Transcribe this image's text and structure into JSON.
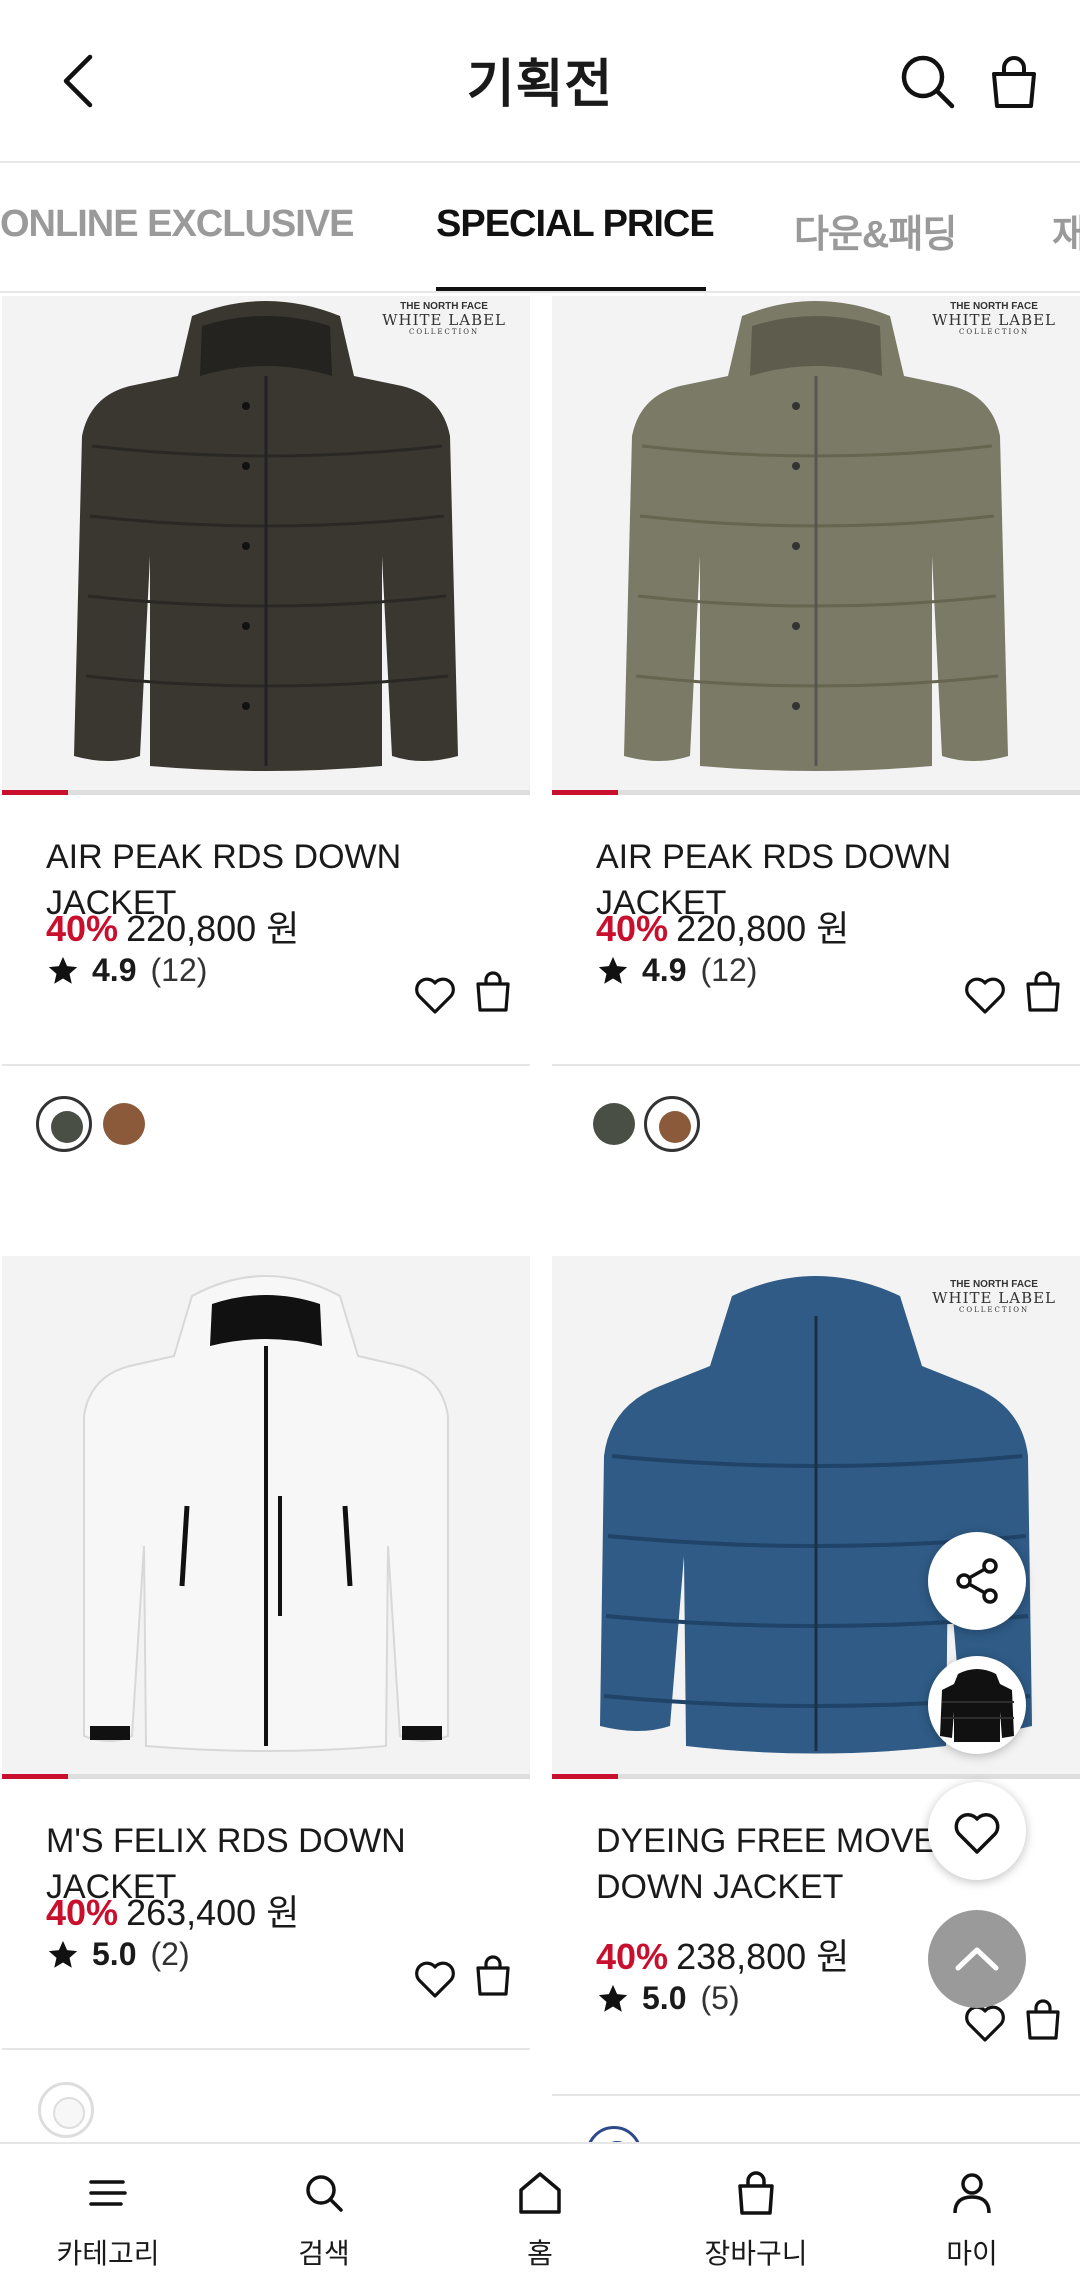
{
  "header": {
    "title": "기획전"
  },
  "tabs": [
    {
      "label": "ONLINE EXCLUSIVE"
    },
    {
      "label": "SPECIAL PRICE"
    },
    {
      "label": "다운&패딩"
    },
    {
      "label": "재"
    }
  ],
  "brand_badge": {
    "tnf": "THE NORTH FACE",
    "line1": "WHITE LABEL",
    "line2": "COLLECTION"
  },
  "products": [
    {
      "name": "AIR PEAK RDS DOWN JACKET",
      "discount": "40%",
      "price": "220,800 원",
      "rating": "4.9",
      "reviews": "(12)",
      "color": "#3a3731"
    },
    {
      "name": "AIR PEAK RDS DOWN JACKET",
      "discount": "40%",
      "price": "220,800 원",
      "rating": "4.9",
      "reviews": "(12)",
      "color": "#7b7a66"
    },
    {
      "name": "M'S FELIX RDS DOWN JACKET",
      "discount": "40%",
      "price": "263,400 원",
      "rating": "5.0",
      "reviews": "(2)",
      "color": "#f7f7f7"
    },
    {
      "name": "DYEING FREE MOVE RDS DOWN JACKET",
      "name_visible": "DYEING FREE MOVE R\nDOWN JACKET",
      "discount": "40%",
      "price": "238,800 원",
      "rating": "5.0",
      "reviews": "(5)",
      "color": "#2f5b86"
    }
  ],
  "swatches": {
    "dark_olive": "#4a4f45",
    "brown": "#8a5a3a"
  },
  "bottom_nav": [
    {
      "label": "카테고리",
      "icon": "menu-icon"
    },
    {
      "label": "검색",
      "icon": "search-icon"
    },
    {
      "label": "홈",
      "icon": "home-icon"
    },
    {
      "label": "장바구니",
      "icon": "bag-icon"
    },
    {
      "label": "마이",
      "icon": "person-icon"
    }
  ],
  "colors": {
    "accent": "#c8102e",
    "text": "#1a1a1a",
    "muted": "#9a9a9a"
  }
}
